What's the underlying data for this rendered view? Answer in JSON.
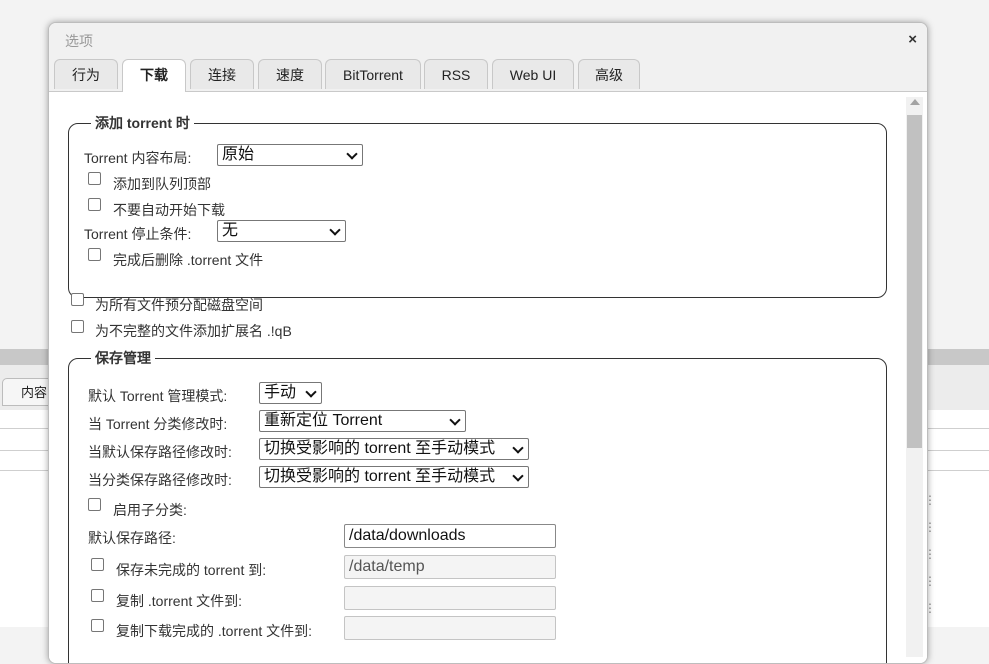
{
  "background_tab": "内容",
  "dialog": {
    "title": "选项",
    "close_glyph": "×",
    "tabs": [
      "行为",
      "下载",
      "连接",
      "速度",
      "BitTorrent",
      "RSS",
      "Web UI",
      "高级"
    ],
    "active_tab": "下载"
  },
  "add_torrent": {
    "legend": "添加 torrent 时",
    "layout_label": "Torrent 内容布局:",
    "layout_value": "原始",
    "add_to_top_label": "添加到队列顶部",
    "no_autostart_label": "不要自动开始下载",
    "stop_condition_label": "Torrent 停止条件:",
    "stop_condition_value": "无",
    "delete_after_label": "完成后删除 .torrent 文件"
  },
  "preallocate_label": "为所有文件预分配磁盘空间",
  "append_ext_label": "为不完整的文件添加扩展名 .!qB",
  "save_management": {
    "legend": "保存管理",
    "default_mode_label": "默认 Torrent 管理模式:",
    "default_mode_value": "手动",
    "category_changed_label": "当 Torrent 分类修改时:",
    "category_changed_value": "重新定位 Torrent",
    "default_path_changed_label": "当默认保存路径修改时:",
    "default_path_changed_value": "切换受影响的 torrent 至手动模式",
    "category_path_changed_label": "当分类保存路径修改时:",
    "category_path_changed_value": "切换受影响的 torrent 至手动模式",
    "subcategories_label": "启用子分类:",
    "default_save_path_label": "默认保存路径:",
    "default_save_path_value": "/data/downloads",
    "incomplete_label": "保存未完成的 torrent 到:",
    "incomplete_value": "/data/temp",
    "copy_torrent_label": "复制 .torrent 文件到:",
    "copy_finished_label": "复制下载完成的 .torrent 文件到:"
  }
}
